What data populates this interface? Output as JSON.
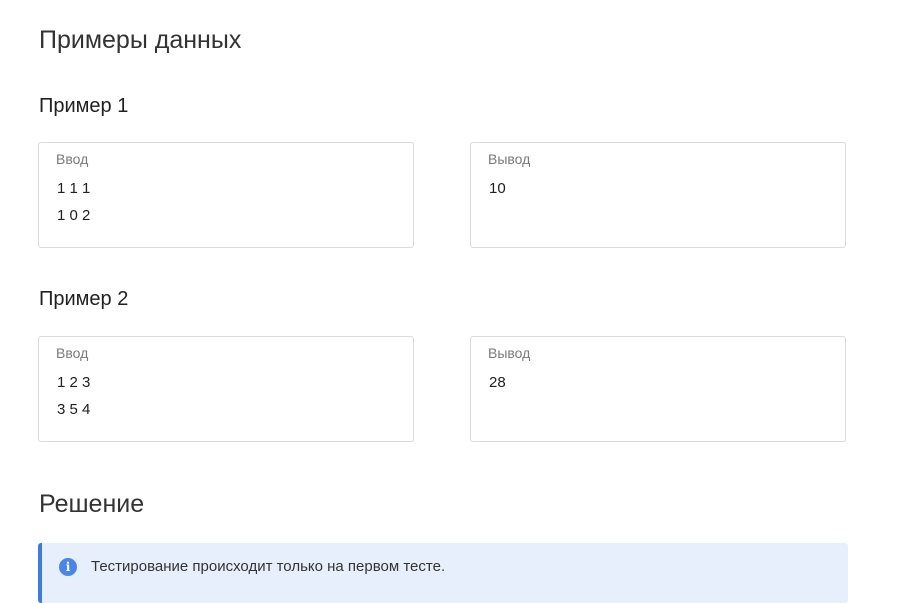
{
  "section_title": "Примеры данных",
  "examples": [
    {
      "title": "Пример 1",
      "input": {
        "caption": "Ввод",
        "lines": [
          "1 1 1",
          "1 0 2"
        ]
      },
      "output": {
        "caption": "Вывод",
        "lines": [
          "10"
        ]
      }
    },
    {
      "title": "Пример 2",
      "input": {
        "caption": "Ввод",
        "lines": [
          "1 2 3",
          "3 5 4"
        ]
      },
      "output": {
        "caption": "Вывод",
        "lines": [
          "28"
        ]
      }
    }
  ],
  "solution": {
    "title": "Решение",
    "notice": {
      "icon": "info-icon",
      "text": "Тестирование происходит только на первом тесте."
    }
  },
  "colors": {
    "accent": "#3b7ddd",
    "notice_bg": "#e8effc"
  }
}
